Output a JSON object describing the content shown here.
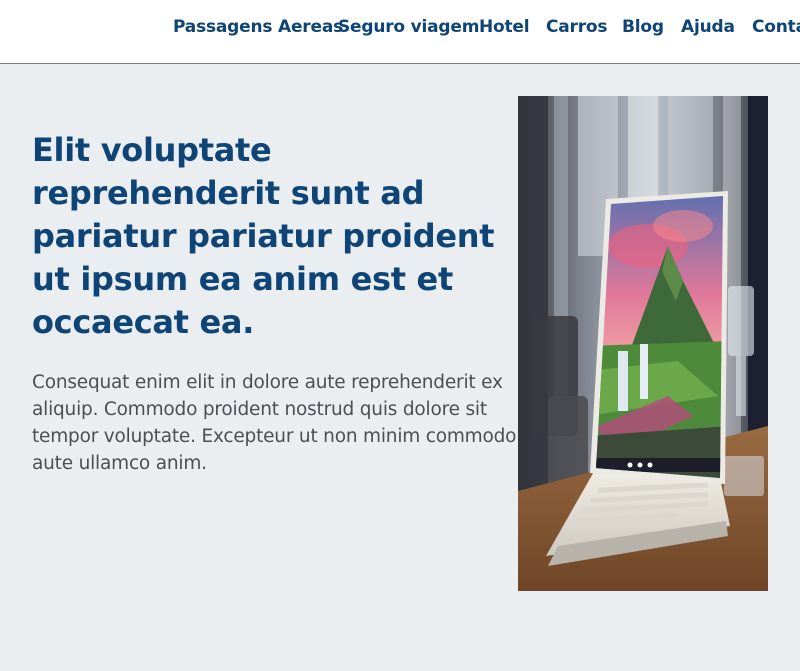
{
  "nav": {
    "items": [
      {
        "label": "Passagens Aereas"
      },
      {
        "label": "Seguro viagem"
      },
      {
        "label": "Hotel"
      },
      {
        "label": "Carros"
      },
      {
        "label": "Blog"
      },
      {
        "label": "Ajuda"
      },
      {
        "label": "Contato"
      }
    ]
  },
  "hero": {
    "headline": "Elit voluptate reprehenderit sunt ad pariatur pariatur proident ut ipsum ea anim est et occaecat ea.",
    "body": "Consequat enim elit in dolore aute reprehenderit ex aliquip. Commodo proident nostrud quis dolore sit tempor voluptate. Excepteur ut non minim commodo aute ullamco anim.",
    "image": {
      "subject": "laptop-with-landscape-wallpaper"
    }
  },
  "colors": {
    "brand": "#0f4576",
    "background": "#eaeef1",
    "body_text": "#4a4f55"
  }
}
